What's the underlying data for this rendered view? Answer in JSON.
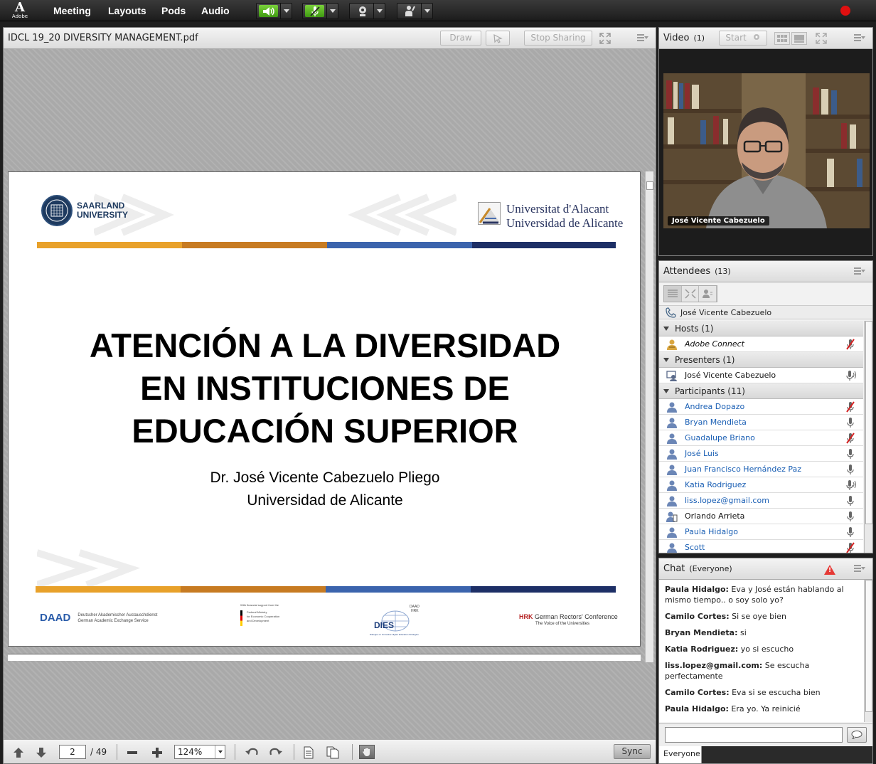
{
  "menubar": {
    "logo_text": "Adobe",
    "items": [
      "Meeting",
      "Layouts",
      "Pods",
      "Audio"
    ]
  },
  "share": {
    "title": "IDCL 19_20 DIVERSITY MANAGEMENT.pdf",
    "draw_label": "Draw",
    "stop_sharing_label": "Stop Sharing",
    "slide": {
      "logo_left_line1": "SAARLAND",
      "logo_left_line2": "UNIVERSITY",
      "logo_right_line1": "Universitat d'Alacant",
      "logo_right_line2": "Universidad de Alicante",
      "title_line1": "ATENCIÓN A LA DIVERSIDAD",
      "title_line2": "EN INSTITUCIONES DE",
      "title_line3": "EDUCACIÓN SUPERIOR",
      "author_line1": "Dr. José Vicente Cabezuelo Pliego",
      "author_line2": "Universidad de Alicante",
      "footer_daad": "DAAD",
      "footer_daad_sub1": "Deutscher Akademischer Austauschdienst",
      "footer_daad_sub2": "German Academic Exchange Service",
      "footer_bmz_top": "With financial support from the",
      "footer_bmz1": "Federal Ministry",
      "footer_bmz2": "for Economic Cooperation",
      "footer_bmz3": "and Development",
      "footer_dies": "DIES",
      "footer_dies_top1": "DAAD",
      "footer_dies_top2": "HRK",
      "footer_dies_sub": "Dialogue on Innovative Higher Education Strategies",
      "footer_hrk": "HRK",
      "footer_hrk_name": "German Rectors' Conference",
      "footer_hrk_sub": "The Voice of the Universities"
    },
    "toolbar": {
      "page": "2",
      "total": "/ 49",
      "zoom": "124%",
      "sync_label": "Sync"
    }
  },
  "video": {
    "title": "Video",
    "count": "(1)",
    "start_label": "Start",
    "speaker_name": "José Vicente Cabezuelo"
  },
  "attendees": {
    "title": "Attendees",
    "count": "(13)",
    "self_name": "José Vicente Cabezuelo",
    "hosts_label": "Hosts (1)",
    "hosts": [
      {
        "name": "Adobe Connect"
      }
    ],
    "presenters_label": "Presenters (1)",
    "presenters": [
      {
        "name": "José Vicente Cabezuelo"
      }
    ],
    "participants_label": "Participants (11)",
    "participants": [
      {
        "name": "Andrea Dopazo"
      },
      {
        "name": "Bryan Mendieta"
      },
      {
        "name": "Guadalupe Briano"
      },
      {
        "name": "José Luis"
      },
      {
        "name": "Juan Francisco Hernández Paz"
      },
      {
        "name": "Katia Rodriguez"
      },
      {
        "name": "liss.lopez@gmail.com"
      },
      {
        "name": "Orlando Arrieta"
      },
      {
        "name": "Paula Hidalgo"
      },
      {
        "name": "Scott"
      }
    ]
  },
  "chat": {
    "title": "Chat",
    "scope": "(Everyone)",
    "messages": [
      {
        "who": "Paula Hidalgo:",
        "text": "Eva y José están hablando al mismo tiempo.. o soy solo yo?"
      },
      {
        "who": "Camilo Cortes:",
        "text": "Si se oye bien"
      },
      {
        "who": "Bryan Mendieta:",
        "text": "si"
      },
      {
        "who": "Katia Rodriguez:",
        "text": "yo si escucho"
      },
      {
        "who": "liss.lopez@gmail.com:",
        "text": "Se escucha perfectamente"
      },
      {
        "who": "Camilo Cortes:",
        "text": "Eva si se escucha bien"
      },
      {
        "who": "Paula Hidalgo:",
        "text": "Era yo. Ya reinicié"
      }
    ],
    "tab_label": "Everyone"
  }
}
